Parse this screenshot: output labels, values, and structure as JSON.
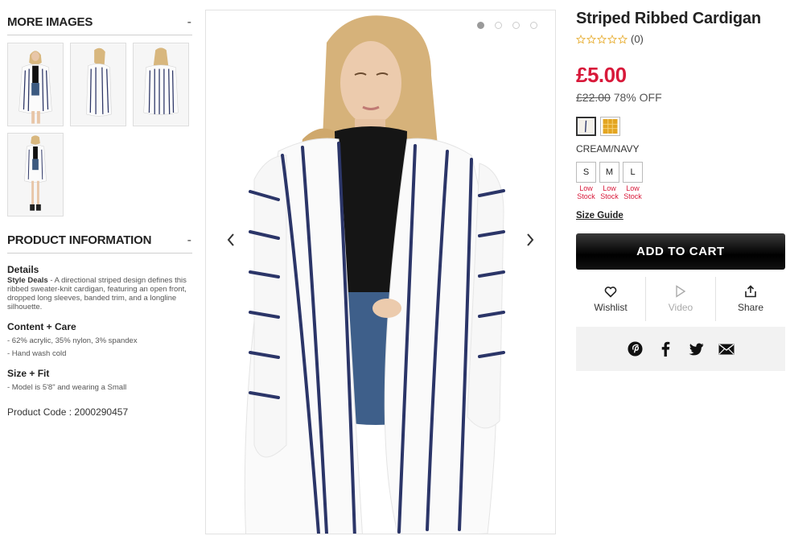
{
  "more_images": {
    "title": "MORE IMAGES",
    "toggle": "-",
    "thumbnails": [
      "thumb-1",
      "thumb-2",
      "thumb-3",
      "thumb-4"
    ]
  },
  "product_info": {
    "title": "PRODUCT INFORMATION",
    "toggle": "-",
    "details_heading": "Details",
    "details_lead": "Style Deals",
    "details_text": " - A directional striped design defines this ribbed sweater-knit cardigan, featuring an open front, dropped long sleeves, banded trim, and a longline silhouette.",
    "content_heading": "Content + Care",
    "content_items": [
      "- 62% acrylic, 35% nylon, 3% spandex",
      "- Hand wash cold"
    ],
    "fit_heading": "Size + Fit",
    "fit_items": [
      "- Model is 5'8\" and wearing a Small"
    ],
    "product_code_label": "Product Code : ",
    "product_code": "2000290457"
  },
  "gallery": {
    "dot_count": 4,
    "active_index": 0,
    "prev_icon": "chevron-left-icon",
    "next_icon": "chevron-right-icon"
  },
  "product": {
    "title": "Striped Ribbed Cardigan",
    "rating_count": "(0)",
    "stars": 0,
    "price": "£5.00",
    "old_price": "£22.00",
    "discount": "78% OFF",
    "color_name": "CREAM/NAVY",
    "sizes": [
      {
        "label": "S",
        "stock": "Low\nStock"
      },
      {
        "label": "M",
        "stock": "Low\nStock"
      },
      {
        "label": "L",
        "stock": "Low\nStock"
      }
    ],
    "size_guide": "Size Guide",
    "add_to_cart": "ADD TO CART"
  },
  "actions": {
    "wishlist": "Wishlist",
    "video": "Video",
    "share": "Share"
  },
  "social": [
    "pinterest-icon",
    "facebook-icon",
    "twitter-icon",
    "email-icon"
  ],
  "colors": {
    "price_red": "#d8193a",
    "star_gold": "#e8b13a",
    "swatch_gold": "#e3a521"
  }
}
